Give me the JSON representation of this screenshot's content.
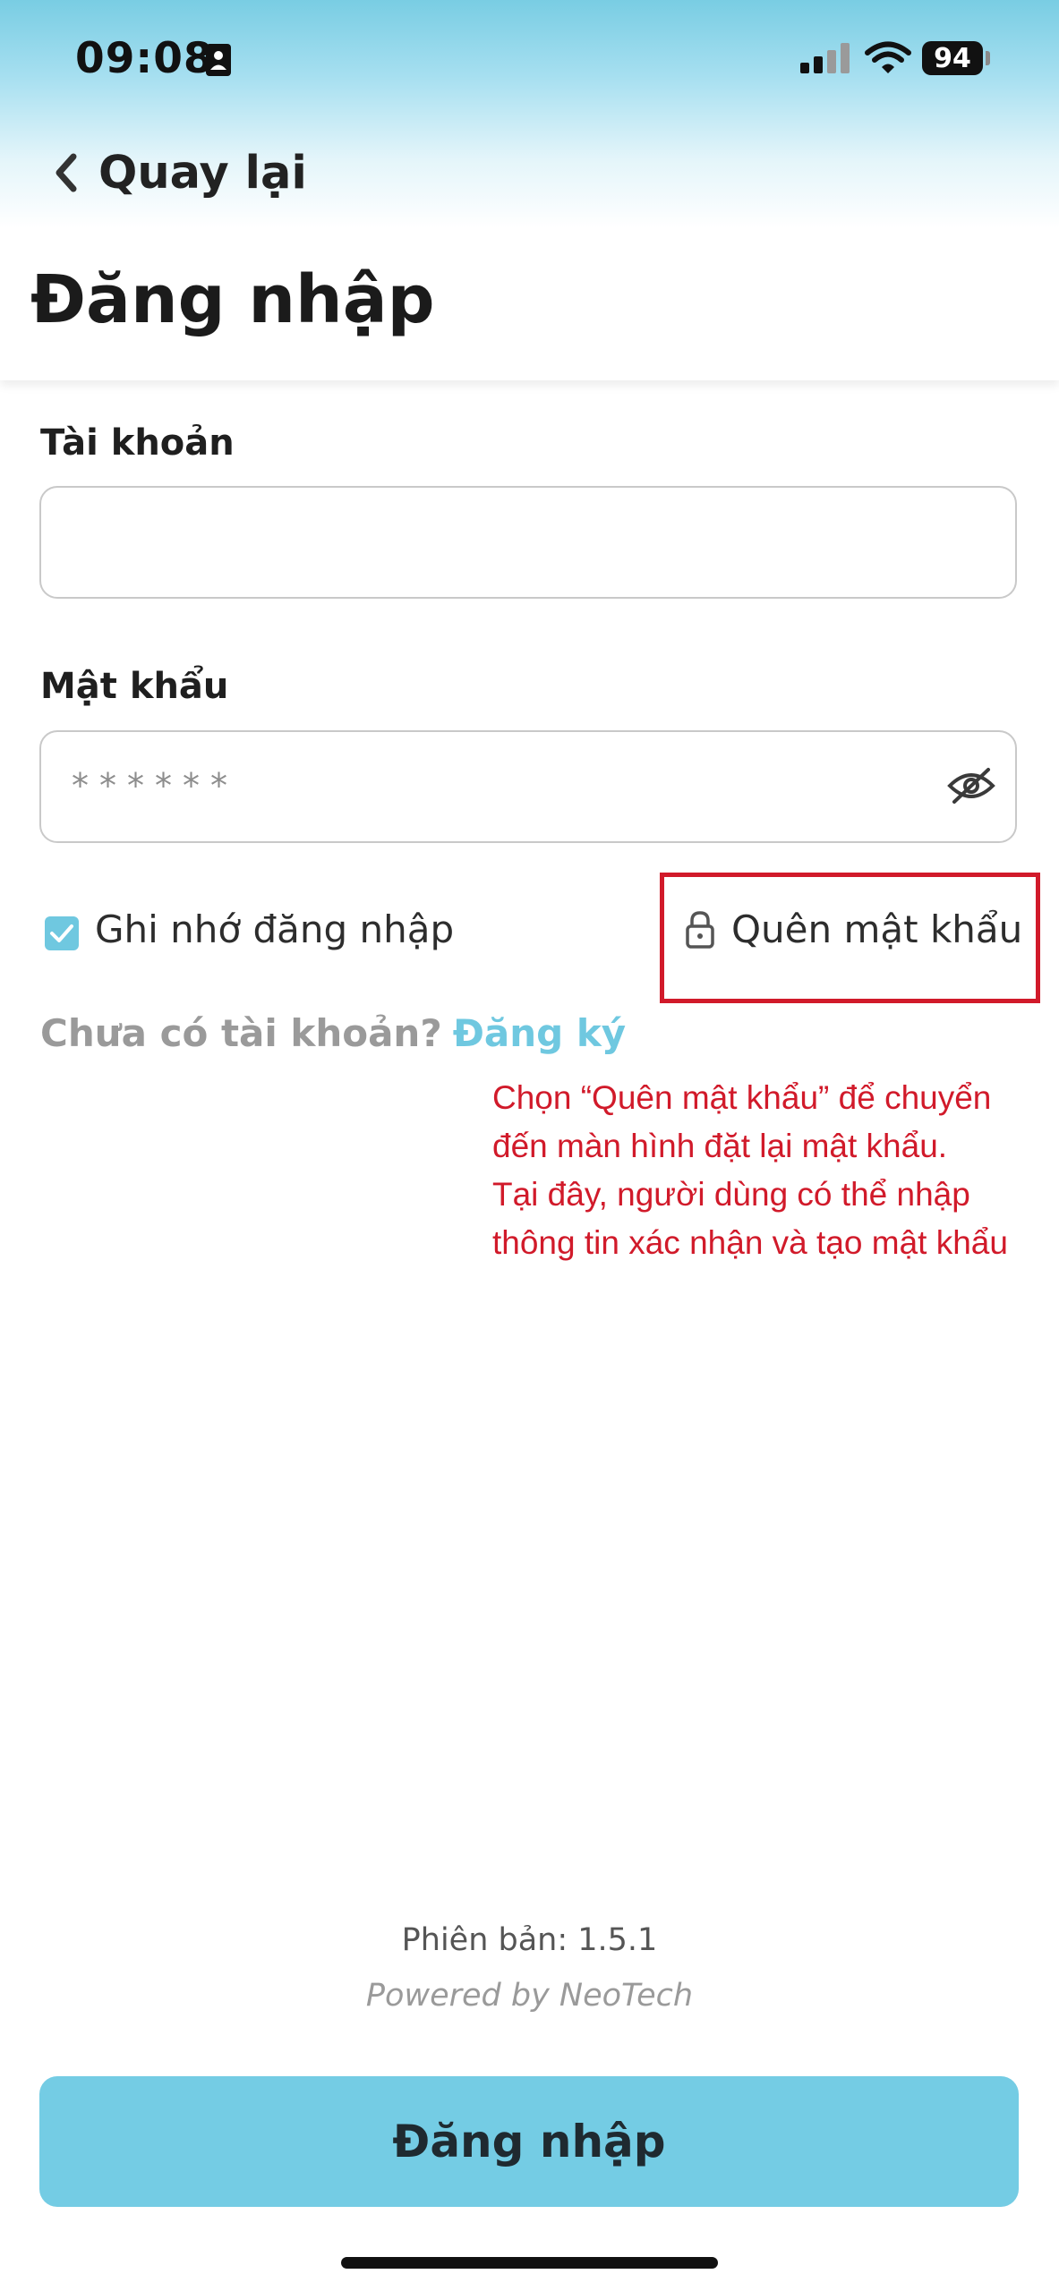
{
  "status_bar": {
    "time": "09:08",
    "battery": "94"
  },
  "header": {
    "back_label": "Quay lại",
    "title": "Đăng nhập"
  },
  "form": {
    "account": {
      "label": "Tài khoản",
      "value": ""
    },
    "password": {
      "label": "Mật khẩu",
      "masked_value": "******"
    },
    "remember": {
      "label": "Ghi nhớ đăng nhập",
      "checked": true
    },
    "forgot_label": "Quên mật khẩu",
    "signup": {
      "question": "Chưa có tài khoản?",
      "link": "Đăng ký"
    }
  },
  "annotation": {
    "lines": [
      "Chọn “Quên mật khẩu” để chuyển",
      "đến màn hình đặt lại mật khẩu.",
      "Tại đây, người dùng có thể nhập",
      "thông tin xác nhận và tạo mật khẩu"
    ]
  },
  "footer": {
    "version": "Phiên bản: 1.5.1",
    "powered": "Powered by NeoTech",
    "login_button": "Đăng nhập"
  },
  "colors": {
    "accent": "#74cce4",
    "annotation": "#d11a2a"
  }
}
